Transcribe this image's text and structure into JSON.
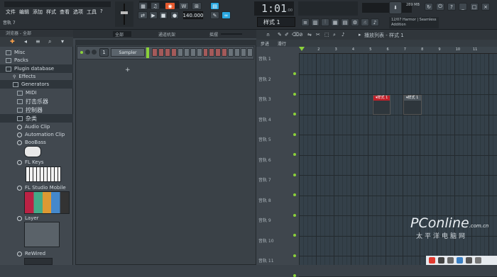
{
  "menu": [
    "文件",
    "编辑",
    "添加",
    "样式",
    "查看",
    "选项",
    "工具",
    "?"
  ],
  "hint_text": "音轨 7",
  "tempo": "140.000",
  "time_display": "1:01",
  "time_sub": ":00",
  "pattern_selector": "样式 1",
  "memory": "289 MB",
  "news_line1": "12/07 Harmor | Seamless",
  "news_line2": "Addition",
  "browser": {
    "header": "浏览器 - 全部",
    "items": [
      {
        "label": "Misc",
        "type": "folder"
      },
      {
        "label": "Packs",
        "type": "folder"
      },
      {
        "label": "Plugin database",
        "type": "folder",
        "selected": true
      },
      {
        "label": "Effects",
        "type": "sub"
      },
      {
        "label": "Generators",
        "type": "sub"
      },
      {
        "label": "MIDI",
        "type": "sub2"
      },
      {
        "label": "打击乐器",
        "type": "sub2"
      },
      {
        "label": "控制器",
        "type": "sub2"
      },
      {
        "label": "杂类",
        "type": "sub2",
        "selected": true
      },
      {
        "label": "Audio Clip",
        "type": "plugin"
      },
      {
        "label": "Automation Clip",
        "type": "plugin"
      },
      {
        "label": "BooBass",
        "type": "plugin"
      },
      {
        "label": "FL Keys",
        "type": "plugin"
      },
      {
        "label": "FL Studio Mobile",
        "type": "plugin"
      },
      {
        "label": "Layer",
        "type": "plugin"
      },
      {
        "label": "ReWired",
        "type": "plugin"
      }
    ]
  },
  "rack": {
    "title": "通道机架",
    "filter": "全部",
    "swing_label": "摇摆",
    "channel_number": "1",
    "channel_name": "Sampler",
    "add_label": "+"
  },
  "playlist": {
    "title": "播放列表 - 样式 1",
    "step_label": "步进",
    "mode_label": "滑行",
    "ruler": [
      "2",
      "3",
      "4",
      "5",
      "6",
      "7",
      "8",
      "9",
      "10",
      "11"
    ],
    "tracks": [
      "音轨 1",
      "音轨 2",
      "音轨 3",
      "音轨 4",
      "音轨 5",
      "音轨 6",
      "音轨 7",
      "音轨 8",
      "音轨 9",
      "音轨 10",
      "音轨 11"
    ],
    "clips": [
      {
        "label": "样式 1",
        "color": "#c0202a"
      },
      {
        "label": "样式 1",
        "color": "#4c555c"
      }
    ]
  },
  "watermark": {
    "line1": "PConline",
    "line2": "太平洋电脑网",
    "domain": ".com.cn"
  },
  "colors": {
    "accent": "#2aa7e0",
    "clip_red": "#c0202a",
    "led": "#8bd13a"
  }
}
